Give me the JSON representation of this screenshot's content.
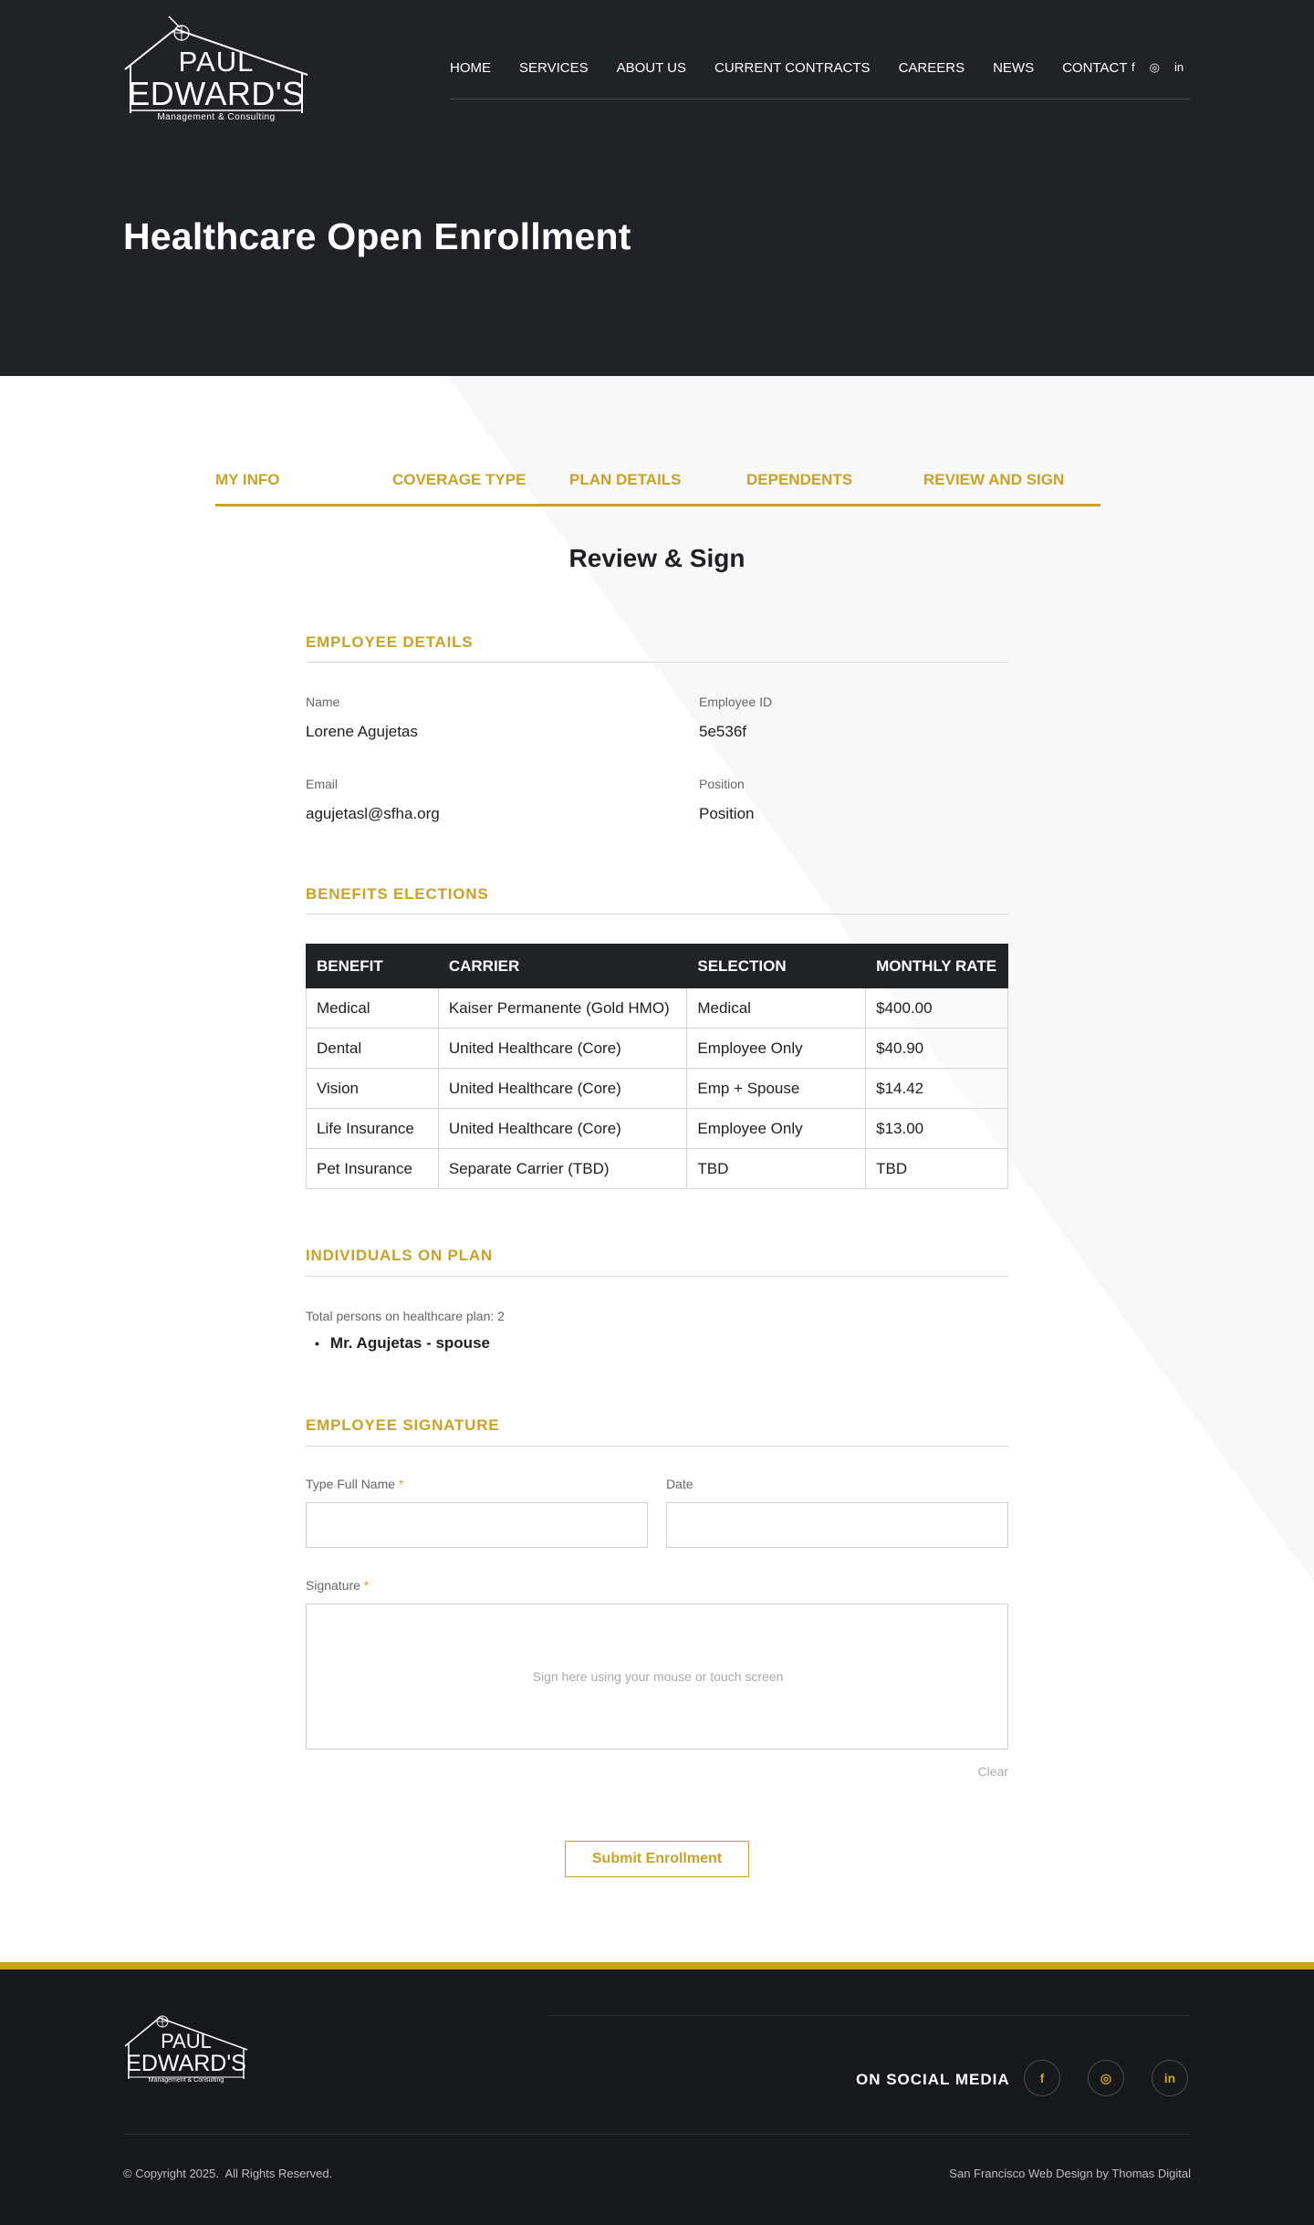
{
  "logo": {
    "line1": "PAUL",
    "line2": "EDWARD'S",
    "line3": "Management & Consulting"
  },
  "nav": [
    "HOME",
    "SERVICES",
    "ABOUT US",
    "CURRENT CONTRACTS",
    "CAREERS",
    "NEWS",
    "CONTACT"
  ],
  "header_social": {
    "facebook": "f",
    "instagram": "◎",
    "linkedin": "in"
  },
  "hero": {
    "title": "Healthcare Open Enrollment"
  },
  "steps": [
    "MY INFO",
    "COVERAGE TYPE",
    "PLAN DETAILS",
    "DEPENDENTS",
    "REVIEW AND SIGN"
  ],
  "review_title": "Review & Sign",
  "employee_details": {
    "heading": "EMPLOYEE DETAILS",
    "name_label": "Name",
    "name_value": "Lorene Agujetas",
    "id_label": "Employee ID",
    "id_value": "5e536f",
    "email_label": "Email",
    "email_value": "agujetasl@sfha.org",
    "position_label": "Position",
    "position_value": "Position"
  },
  "benefits": {
    "heading": "BENEFITS ELECTIONS",
    "columns": [
      "BENEFIT",
      "CARRIER",
      "SELECTION",
      "MONTHLY RATE"
    ],
    "rows": [
      [
        "Medical",
        "Kaiser Permanente (Gold HMO)",
        "Medical",
        "$400.00"
      ],
      [
        "Dental",
        "United Healthcare (Core)",
        "Employee Only",
        "$40.90"
      ],
      [
        "Vision",
        "United Healthcare (Core)",
        "Emp + Spouse",
        "$14.42"
      ],
      [
        "Life Insurance",
        "United Healthcare (Core)",
        "Employee Only",
        "$13.00"
      ],
      [
        "Pet Insurance",
        "Separate Carrier (TBD)",
        "TBD",
        "TBD"
      ]
    ]
  },
  "individuals": {
    "heading": "INDIVIDUALS ON PLAN",
    "total_text": "Total persons on healthcare plan: 2",
    "persons": [
      "Mr. Agujetas - spouse"
    ]
  },
  "signature": {
    "heading": "EMPLOYEE SIGNATURE",
    "full_name_label": "Type Full Name",
    "date_label": "Date",
    "signature_label": "Signature",
    "required_mark": "*",
    "pad_hint": "Sign here using your mouse or touch screen",
    "clear_label": "Clear",
    "full_name_value": "",
    "date_value": ""
  },
  "submit_label": "Submit Enrollment",
  "footer": {
    "logo_line1": "PAUL",
    "logo_line2": "EDWARD'S",
    "logo_line3": "Management & Consulting",
    "on_social": "ON SOCIAL MEDIA",
    "social": {
      "facebook": "f",
      "instagram": "◎",
      "linkedin": "in"
    },
    "copyright": "© Copyright 2025.  All Rights Reserved.",
    "credit": "San Francisco Web Design by Thomas Digital"
  },
  "colors": {
    "accent": "#c9a227",
    "dark": "#212225",
    "footer": "#16181c"
  }
}
